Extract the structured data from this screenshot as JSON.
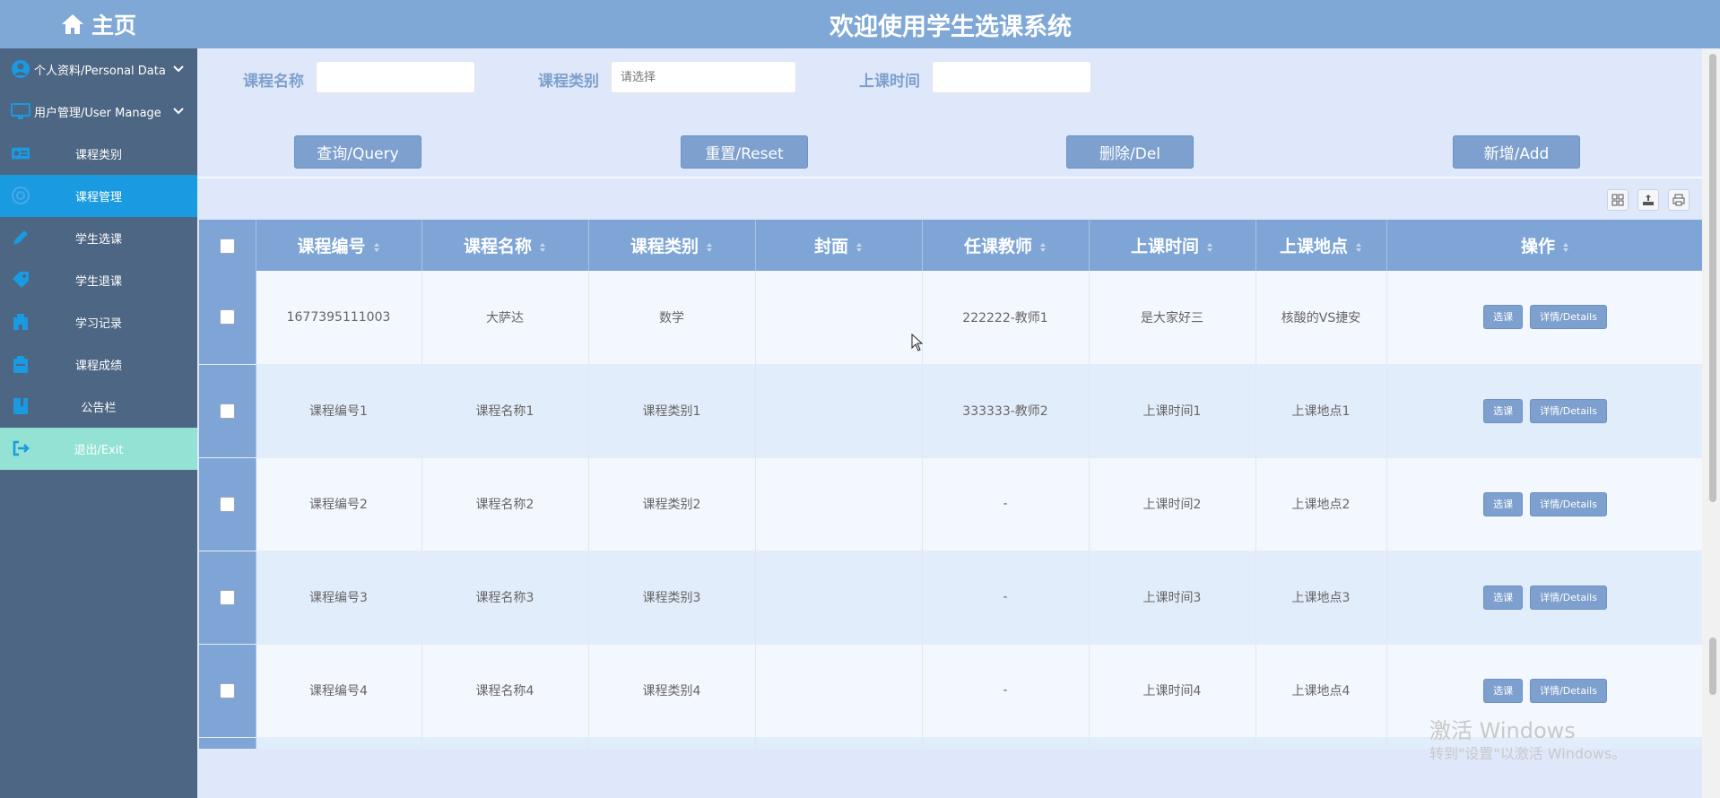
{
  "brand": {
    "label": "主页"
  },
  "header": {
    "title": "欢迎使用学生选课系统"
  },
  "sidebar": {
    "items": [
      {
        "label": "个人资料/Personal Data",
        "icon": "user-circle-icon",
        "expandable": true
      },
      {
        "label": "用户管理/User Manage",
        "icon": "monitor-icon",
        "expandable": true
      },
      {
        "label": "课程类别",
        "icon": "id-card-icon"
      },
      {
        "label": "课程管理",
        "icon": "settings-icon",
        "active": true
      },
      {
        "label": "学生选课",
        "icon": "pen-icon"
      },
      {
        "label": "学生退课",
        "icon": "tag-icon"
      },
      {
        "label": "学习记录",
        "icon": "building-icon"
      },
      {
        "label": "课程成绩",
        "icon": "clipboard-icon"
      },
      {
        "label": "公告栏",
        "icon": "book-icon"
      },
      {
        "label": "退出/Exit",
        "icon": "logout-icon"
      }
    ]
  },
  "filters": {
    "course_name_label": "课程名称",
    "course_name_value": "",
    "course_type_label": "课程类别",
    "course_type_placeholder": "请选择",
    "time_label": "上课时间",
    "time_value": ""
  },
  "actions": {
    "query": "查询/Query",
    "reset": "重置/Reset",
    "delete": "删除/Del",
    "add": "新增/Add"
  },
  "table": {
    "columns": [
      "课程编号",
      "课程名称",
      "课程类别",
      "封面",
      "任课教师",
      "上课时间",
      "上课地点",
      "操作"
    ],
    "rows": [
      [
        "1677395111003",
        "大萨达",
        "数学",
        "",
        "222222-教师1",
        "是大家好三",
        "核酸的VS捷安"
      ],
      [
        "课程编号1",
        "课程名称1",
        "课程类别1",
        "",
        "333333-教师2",
        "上课时间1",
        "上课地点1"
      ],
      [
        "课程编号2",
        "课程名称2",
        "课程类别2",
        "",
        "-",
        "上课时间2",
        "上课地点2"
      ],
      [
        "课程编号3",
        "课程名称3",
        "课程类别3",
        "",
        "-",
        "上课时间3",
        "上课地点3"
      ],
      [
        "课程编号4",
        "课程名称4",
        "课程类别4",
        "",
        "-",
        "上课时间4",
        "上课地点4"
      ]
    ],
    "row_actions": {
      "select": "选课",
      "details": "详情/Details"
    }
  },
  "watermark": {
    "line1": "激活 Windows",
    "line2": "转到\"设置\"以激活 Windows。"
  },
  "colors": {
    "header": "#7fa8d6",
    "sidebar": "#4d6683",
    "active": "#1a9ae0",
    "exit": "#93e2d4",
    "button": "#7ea0cf",
    "main_bg": "#dfe8fb"
  }
}
